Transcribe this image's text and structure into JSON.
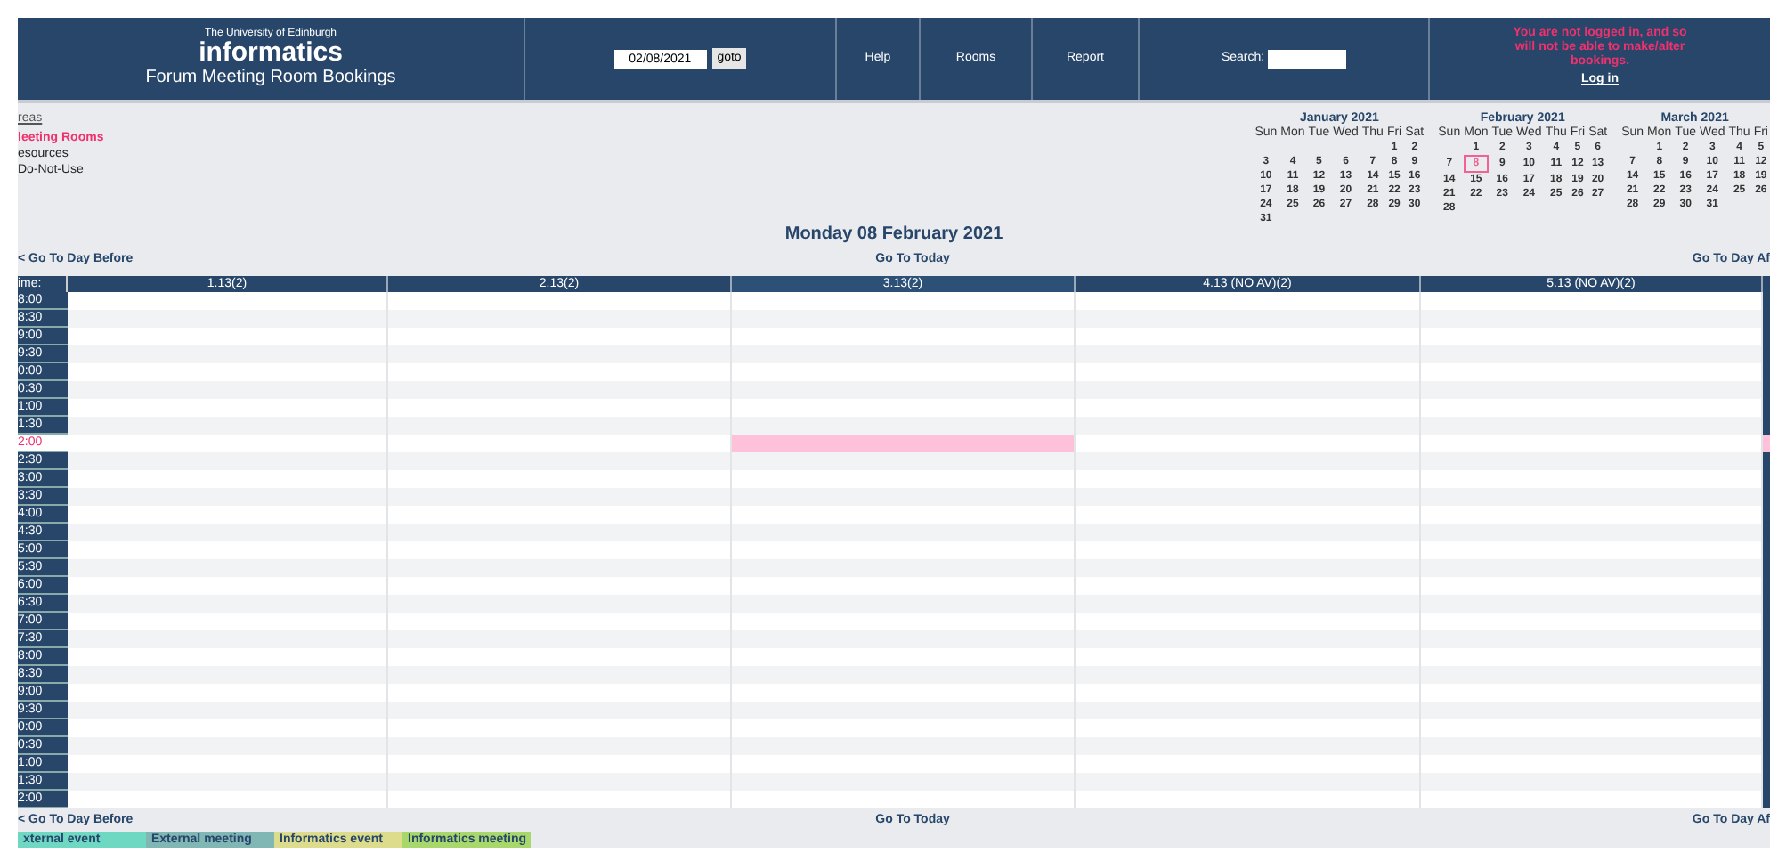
{
  "header": {
    "university": "The University of Edinburgh",
    "logo": "informatics",
    "subtitle": "Forum Meeting Room Bookings",
    "date_value": "02/08/2021",
    "goto_label": "goto",
    "nav": [
      "Help",
      "Rooms",
      "Report"
    ],
    "search_label": "Search:",
    "login_warning": "You are not logged in, and so will not be able to make/alter bookings.",
    "login_link": "Log in"
  },
  "areas": {
    "title": "reas",
    "items": [
      {
        "label": "leeting Rooms",
        "selected": true
      },
      {
        "label": "esources",
        "selected": false
      },
      {
        "label": "Do-Not-Use",
        "selected": false
      }
    ]
  },
  "calendars": [
    {
      "title": "January 2021",
      "weekdays": [
        "Sun",
        "Mon",
        "Tue",
        "Wed",
        "Thu",
        "Fri",
        "Sat"
      ],
      "weeks": [
        {
          "kind": "leading",
          "days": [
            {
              "day": "1",
              "selected": false
            },
            {
              "day": "2",
              "selected": false
            }
          ]
        },
        {
          "kind": "full",
          "days": [
            {
              "day": "3",
              "selected": false
            },
            {
              "day": "4",
              "selected": false
            },
            {
              "day": "5",
              "selected": false
            },
            {
              "day": "6",
              "selected": false
            },
            {
              "day": "7",
              "selected": false
            },
            {
              "day": "8",
              "selected": false
            },
            {
              "day": "9",
              "selected": false
            }
          ]
        },
        {
          "kind": "full",
          "days": [
            {
              "day": "10",
              "selected": false
            },
            {
              "day": "11",
              "selected": false
            },
            {
              "day": "12",
              "selected": false
            },
            {
              "day": "13",
              "selected": false
            },
            {
              "day": "14",
              "selected": false
            },
            {
              "day": "15",
              "selected": false
            },
            {
              "day": "16",
              "selected": false
            }
          ]
        },
        {
          "kind": "full",
          "days": [
            {
              "day": "17",
              "selected": false
            },
            {
              "day": "18",
              "selected": false
            },
            {
              "day": "19",
              "selected": false
            },
            {
              "day": "20",
              "selected": false
            },
            {
              "day": "21",
              "selected": false
            },
            {
              "day": "22",
              "selected": false
            },
            {
              "day": "23",
              "selected": false
            }
          ]
        },
        {
          "kind": "full",
          "days": [
            {
              "day": "24",
              "selected": false
            },
            {
              "day": "25",
              "selected": false
            },
            {
              "day": "26",
              "selected": false
            },
            {
              "day": "27",
              "selected": false
            },
            {
              "day": "28",
              "selected": false
            },
            {
              "day": "29",
              "selected": false
            },
            {
              "day": "30",
              "selected": false
            }
          ]
        },
        {
          "kind": "trailing",
          "days": [
            {
              "day": "31",
              "selected": false
            }
          ]
        }
      ]
    },
    {
      "title": "February 2021",
      "weekdays": [
        "Sun",
        "Mon",
        "Tue",
        "Wed",
        "Thu",
        "Fri",
        "Sat"
      ],
      "weeks": [
        {
          "kind": "leading",
          "days": [
            {
              "day": "1",
              "selected": false
            },
            {
              "day": "2",
              "selected": false
            },
            {
              "day": "3",
              "selected": false
            },
            {
              "day": "4",
              "selected": false
            },
            {
              "day": "5",
              "selected": false
            },
            {
              "day": "6",
              "selected": false
            }
          ]
        },
        {
          "kind": "full",
          "days": [
            {
              "day": "7",
              "selected": false
            },
            {
              "day": "8",
              "selected": true
            },
            {
              "day": "9",
              "selected": false
            },
            {
              "day": "10",
              "selected": false
            },
            {
              "day": "11",
              "selected": false
            },
            {
              "day": "12",
              "selected": false
            },
            {
              "day": "13",
              "selected": false
            }
          ]
        },
        {
          "kind": "full",
          "days": [
            {
              "day": "14",
              "selected": false
            },
            {
              "day": "15",
              "selected": false
            },
            {
              "day": "16",
              "selected": false
            },
            {
              "day": "17",
              "selected": false
            },
            {
              "day": "18",
              "selected": false
            },
            {
              "day": "19",
              "selected": false
            },
            {
              "day": "20",
              "selected": false
            }
          ]
        },
        {
          "kind": "full",
          "days": [
            {
              "day": "21",
              "selected": false
            },
            {
              "day": "22",
              "selected": false
            },
            {
              "day": "23",
              "selected": false
            },
            {
              "day": "24",
              "selected": false
            },
            {
              "day": "25",
              "selected": false
            },
            {
              "day": "26",
              "selected": false
            },
            {
              "day": "27",
              "selected": false
            }
          ]
        },
        {
          "kind": "trailing",
          "days": [
            {
              "day": "28",
              "selected": false
            }
          ]
        }
      ]
    },
    {
      "title": "March 2021",
      "weekdays": [
        "Sun",
        "Mon",
        "Tue",
        "Wed",
        "Thu",
        "Fri"
      ],
      "weeks": [
        {
          "kind": "leading",
          "days": [
            {
              "day": "1",
              "selected": false
            },
            {
              "day": "2",
              "selected": false
            },
            {
              "day": "3",
              "selected": false
            },
            {
              "day": "4",
              "selected": false
            },
            {
              "day": "5",
              "selected": false
            }
          ]
        },
        {
          "kind": "full",
          "days": [
            {
              "day": "7",
              "selected": false
            },
            {
              "day": "8",
              "selected": false
            },
            {
              "day": "9",
              "selected": false
            },
            {
              "day": "10",
              "selected": false
            },
            {
              "day": "11",
              "selected": false
            },
            {
              "day": "12",
              "selected": false
            }
          ]
        },
        {
          "kind": "full",
          "days": [
            {
              "day": "14",
              "selected": false
            },
            {
              "day": "15",
              "selected": false
            },
            {
              "day": "16",
              "selected": false
            },
            {
              "day": "17",
              "selected": false
            },
            {
              "day": "18",
              "selected": false
            },
            {
              "day": "19",
              "selected": false
            }
          ]
        },
        {
          "kind": "full",
          "days": [
            {
              "day": "21",
              "selected": false
            },
            {
              "day": "22",
              "selected": false
            },
            {
              "day": "23",
              "selected": false
            },
            {
              "day": "24",
              "selected": false
            },
            {
              "day": "25",
              "selected": false
            },
            {
              "day": "26",
              "selected": false
            }
          ]
        },
        {
          "kind": "trailing",
          "days": [
            {
              "day": "28",
              "selected": false
            },
            {
              "day": "29",
              "selected": false
            },
            {
              "day": "30",
              "selected": false
            },
            {
              "day": "31",
              "selected": false
            }
          ]
        }
      ]
    }
  ],
  "day_title": "Monday 08 February 2021",
  "top_nav": {
    "before": "< Go To Day Before",
    "today": "Go To Today",
    "after": "Go To Day Af"
  },
  "grid": {
    "time_label": "ime:",
    "columns": [
      {
        "label": "1.13(2)",
        "selected": false
      },
      {
        "label": "2.13(2)",
        "selected": false
      },
      {
        "label": "3.13(2)",
        "selected": true
      },
      {
        "label": "4.13 (NO AV)(2)",
        "selected": false
      },
      {
        "label": "5.13 (NO AV)(2)",
        "selected": false
      }
    ],
    "rows": [
      {
        "time": "8:00",
        "current": false
      },
      {
        "time": "8:30",
        "current": false
      },
      {
        "time": "9:00",
        "current": false
      },
      {
        "time": "9:30",
        "current": false
      },
      {
        "time": "0:00",
        "current": false
      },
      {
        "time": "0:30",
        "current": false
      },
      {
        "time": "1:00",
        "current": false
      },
      {
        "time": "1:30",
        "current": false
      },
      {
        "time": "2:00",
        "current": true
      },
      {
        "time": "2:30",
        "current": false
      },
      {
        "time": "3:00",
        "current": false
      },
      {
        "time": "3:30",
        "current": false
      },
      {
        "time": "4:00",
        "current": false
      },
      {
        "time": "4:30",
        "current": false
      },
      {
        "time": "5:00",
        "current": false
      },
      {
        "time": "5:30",
        "current": false
      },
      {
        "time": "6:00",
        "current": false
      },
      {
        "time": "6:30",
        "current": false
      },
      {
        "time": "7:00",
        "current": false
      },
      {
        "time": "7:30",
        "current": false
      },
      {
        "time": "8:00",
        "current": false
      },
      {
        "time": "8:30",
        "current": false
      },
      {
        "time": "9:00",
        "current": false
      },
      {
        "time": "9:30",
        "current": false
      },
      {
        "time": "0:00",
        "current": false
      },
      {
        "time": "0:30",
        "current": false
      },
      {
        "time": "1:00",
        "current": false
      },
      {
        "time": "1:30",
        "current": false
      },
      {
        "time": "2:00",
        "current": false
      }
    ]
  },
  "bottom_nav": {
    "before": "< Go To Day Before",
    "today": "Go To Today",
    "after": "Go To Day Af"
  },
  "legend": [
    {
      "label": "xternal event",
      "color": "#6fd8c2"
    },
    {
      "label": "External meeting",
      "color": "#80b6b4"
    },
    {
      "label": "Informatics event",
      "color": "#dcdc8c"
    },
    {
      "label": "Informatics meeting",
      "color": "#a8d86c"
    }
  ]
}
